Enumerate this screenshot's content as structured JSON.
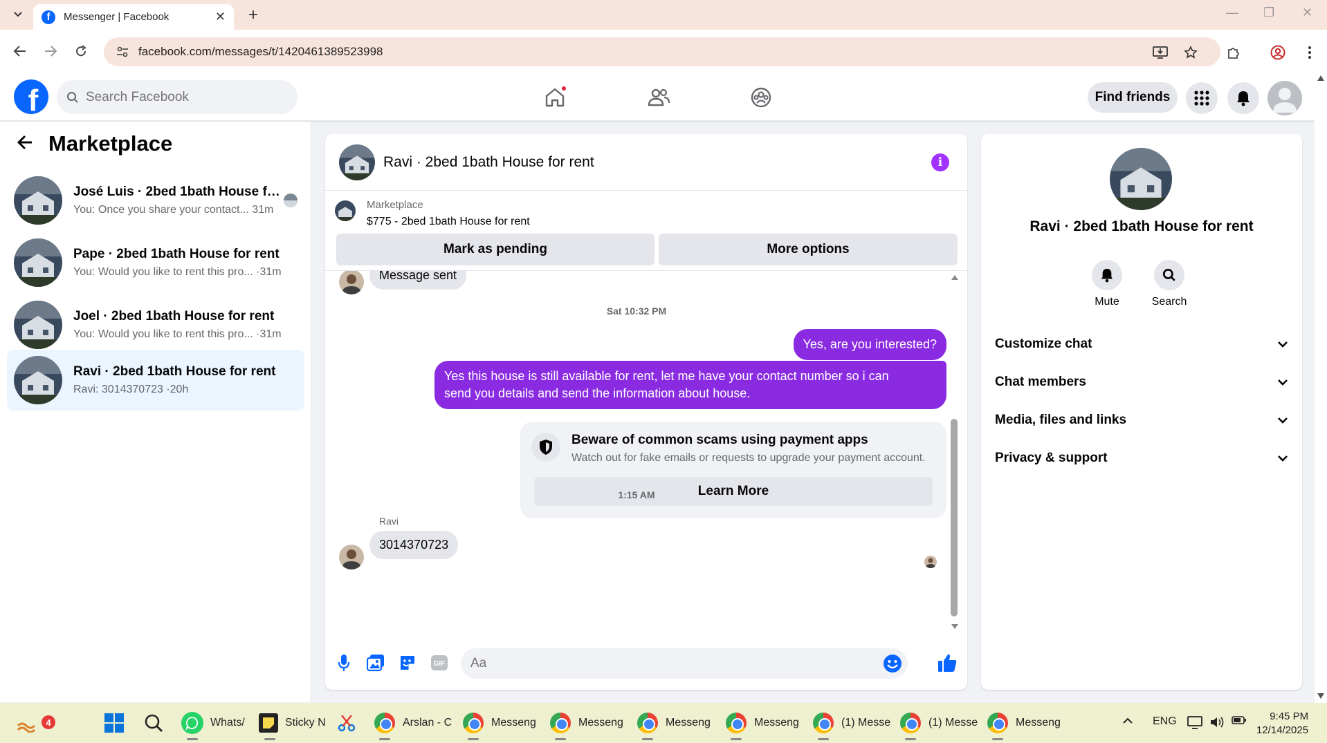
{
  "browser": {
    "tab_title": "Messenger | Facebook",
    "url": "facebook.com/messages/t/1420461389523998"
  },
  "fb_header": {
    "search_placeholder": "Search Facebook",
    "find_friends_label": "Find friends"
  },
  "sidebar": {
    "title": "Marketplace",
    "conversations": [
      {
        "name": "José Luis · 2bed 1bath House for...",
        "preview": "You: Once you share your contact... 31m"
      },
      {
        "name": "Pape · 2bed 1bath House for rent",
        "preview": "You: Would you like to rent this pro... ·31m"
      },
      {
        "name": "Joel · 2bed 1bath House for rent",
        "preview": "You: Would you like to rent this pro... ·31m"
      },
      {
        "name": "Ravi · 2bed 1bath House for rent",
        "preview": "Ravi: 3014370723 ·20h"
      }
    ]
  },
  "chat": {
    "title": "Ravi · 2bed 1bath House for rent",
    "marketplace_label": "Marketplace",
    "listing": "$775 - 2bed 1bath House for rent",
    "mark_pending_label": "Mark as pending",
    "more_options_label": "More options",
    "messages": {
      "first_incoming": "Message sent",
      "timestamp_1": "Sat 10:32 PM",
      "outgoing_1": "Yes, are you interested?",
      "outgoing_2_line1": "Yes this house is still available for rent, let me have your contact number so i can",
      "outgoing_2_line2": "send you details and send the information about house.",
      "timestamp_2": "1:15 AM",
      "sender_name": "Ravi",
      "incoming_2": "3014370723"
    },
    "scam_card": {
      "title": "Beware of common scams using payment apps",
      "subtitle": "Watch out for fake emails or requests to upgrade your payment account.",
      "button": "Learn More"
    },
    "composer_placeholder": "Aa",
    "gif_label": "GIF"
  },
  "info_panel": {
    "name": "Ravi · 2bed 1bath House for rent",
    "mute_label": "Mute",
    "search_label": "Search",
    "sections": [
      "Customize chat",
      "Chat members",
      "Media, files and links",
      "Privacy & support"
    ]
  },
  "taskbar": {
    "notification_count": "4",
    "items": [
      "Whats/",
      "Sticky N",
      "Arslan - C",
      "Messeng",
      "Messeng",
      "Messeng",
      "Messeng",
      "(1) Messe",
      "(1) Messe",
      "Messeng"
    ],
    "language": "ENG",
    "time": "9:45 PM",
    "date": "12/14/2025"
  },
  "colors": {
    "fb_blue": "#0866ff",
    "outgoing_bubble": "#8a2be2",
    "info_purple": "#a033ff",
    "active_convo_bg": "#ebf5ff"
  }
}
